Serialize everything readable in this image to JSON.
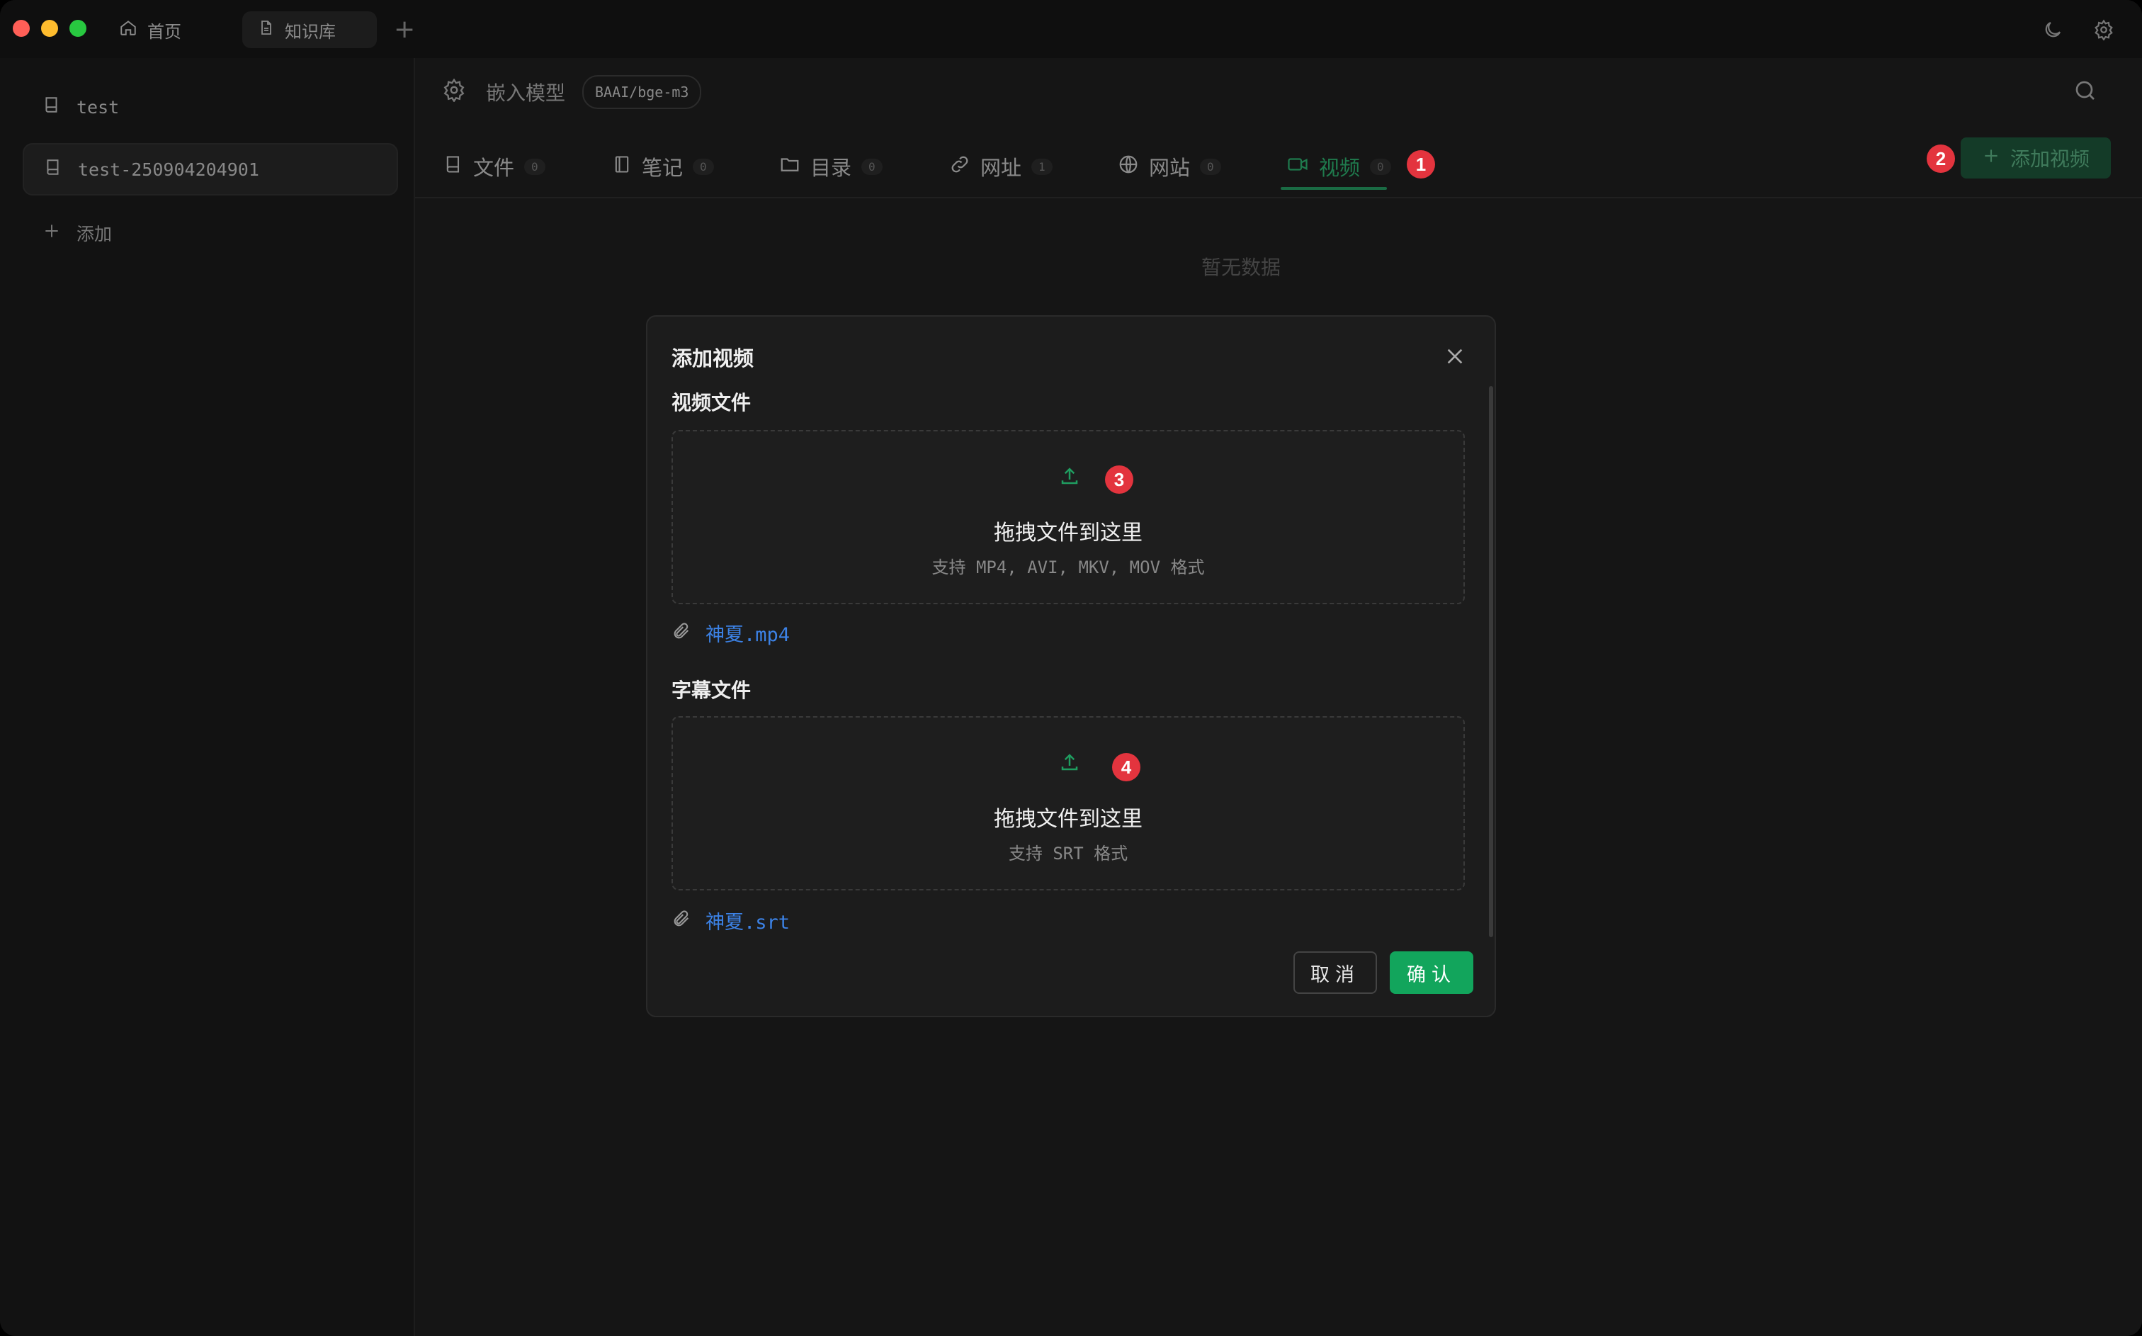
{
  "titlebar": {
    "tabs": [
      {
        "label": "首页",
        "icon": "home-icon"
      },
      {
        "label": "知识库",
        "icon": "document-icon"
      }
    ],
    "new_tab": "+",
    "right_icons": [
      "moon-icon",
      "gear-icon"
    ]
  },
  "sidebar": {
    "items": [
      {
        "label": "test"
      },
      {
        "label": "test-250904204901"
      }
    ],
    "add_label": "添加"
  },
  "header": {
    "embedding_label": "嵌入模型",
    "embedding_model": "BAAI/bge-m3"
  },
  "tabs": [
    {
      "label": "文件",
      "count": "0"
    },
    {
      "label": "笔记",
      "count": "0"
    },
    {
      "label": "目录",
      "count": "0"
    },
    {
      "label": "网址",
      "count": "1"
    },
    {
      "label": "网站",
      "count": "0"
    },
    {
      "label": "视频",
      "count": "0"
    }
  ],
  "active_tab": "视频",
  "add_video_button": "添加视频",
  "empty_text": "暂无数据",
  "markers": [
    "1",
    "2",
    "3",
    "4"
  ],
  "modal": {
    "title": "添加视频",
    "video_section": {
      "title": "视频文件",
      "drop_main": "拖拽文件到这里",
      "drop_sub": "支持 MP4, AVI, MKV, MOV 格式",
      "file": "神夏.mp4"
    },
    "subtitle_section": {
      "title": "字幕文件",
      "drop_main": "拖拽文件到这里",
      "drop_sub": "支持 SRT 格式",
      "file": "神夏.srt"
    },
    "cancel": "取消",
    "confirm": "确认"
  },
  "colors": {
    "accent": "#12a55c",
    "marker": "#e3343e",
    "link": "#3c82e6"
  }
}
